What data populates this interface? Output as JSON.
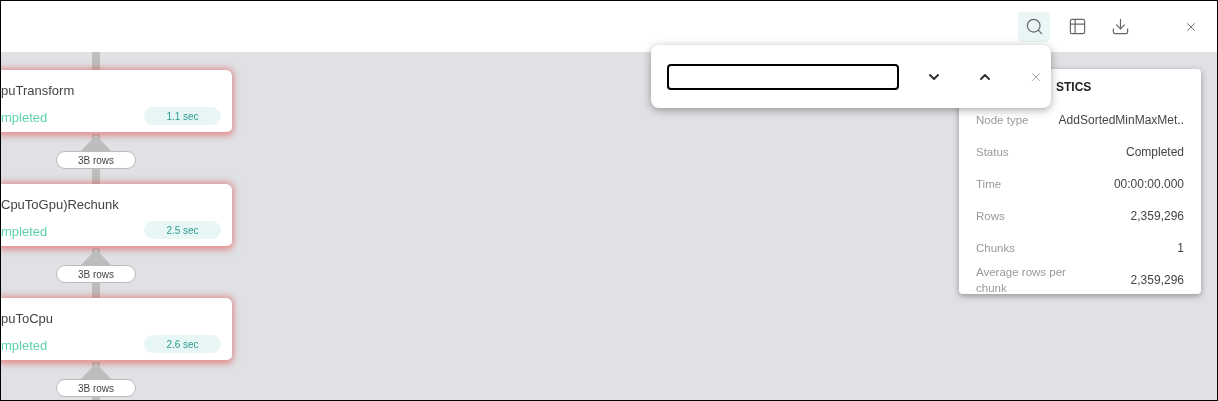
{
  "toolbar": [
    {
      "kind": "search",
      "selected": true
    },
    {
      "kind": "table",
      "selected": false
    },
    {
      "kind": "download",
      "selected": false
    },
    {
      "kind": "close",
      "selected": false
    }
  ],
  "search_popup": {
    "focused": true
  },
  "nodes": [
    {
      "name": "puTransform",
      "status": "mpleted",
      "time": "1.1 sec"
    },
    {
      "name": "CpuToGpu)Rechunk",
      "status": "mpleted",
      "time": "2.5 sec"
    },
    {
      "name": "puToCpu",
      "status": "mpleted",
      "time": "2.6 sec"
    }
  ],
  "edges": [
    {
      "label": "3B rows"
    },
    {
      "label": "3B rows"
    },
    {
      "label": "3B rows"
    }
  ],
  "statistics": {
    "title": "STICS",
    "rows": [
      {
        "label": "Node type",
        "value": "AddSortedMinMaxMet.."
      },
      {
        "label": "Status",
        "value": "Completed"
      },
      {
        "label": "Time",
        "value": "00:00:00.000"
      },
      {
        "label": "Rows",
        "value": "2,359,296"
      },
      {
        "label": "Chunks",
        "value": "1"
      },
      {
        "label": "Average rows per chunk",
        "value": "2,359,296"
      }
    ]
  }
}
